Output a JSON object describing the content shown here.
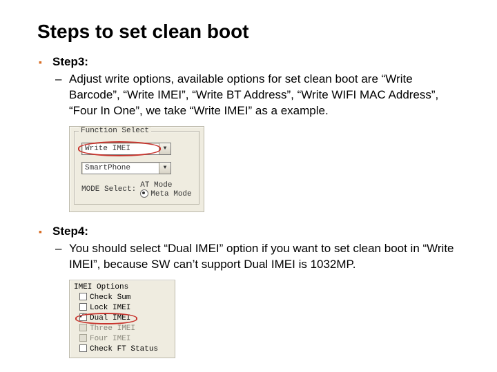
{
  "title": "Steps to set clean boot",
  "steps": [
    {
      "label": "Step3:",
      "desc": "Adjust write options, available options for set clean boot are “Write Barcode”, “Write IMEI”, “Write BT Address”, “Write WIFI MAC Address”, “Four In One”, we take “Write IMEI” as a example."
    },
    {
      "label": "Step4:",
      "desc": "You should select “Dual IMEI” option if you want to set clean boot in “Write IMEI”, because SW can’t support Dual IMEI is 1032MP."
    }
  ],
  "function_select": {
    "legend": "Function Select",
    "combo1": "Write IMEI",
    "combo2": "SmartPhone",
    "mode_label": "MODE Select:",
    "mode_at": "AT Mode",
    "mode_meta": "Meta Mode"
  },
  "imei_options": {
    "title": "IMEI Options",
    "items": [
      {
        "label": "Check Sum",
        "checked": false,
        "disabled": false
      },
      {
        "label": "Lock IMEI",
        "checked": false,
        "disabled": false
      },
      {
        "label": "Dual IMEI",
        "checked": true,
        "disabled": false,
        "highlight": true
      },
      {
        "label": "Three IMEI",
        "checked": false,
        "disabled": true
      },
      {
        "label": "Four IMEI",
        "checked": false,
        "disabled": true
      },
      {
        "label": "Check FT Status",
        "checked": false,
        "disabled": false
      }
    ]
  }
}
